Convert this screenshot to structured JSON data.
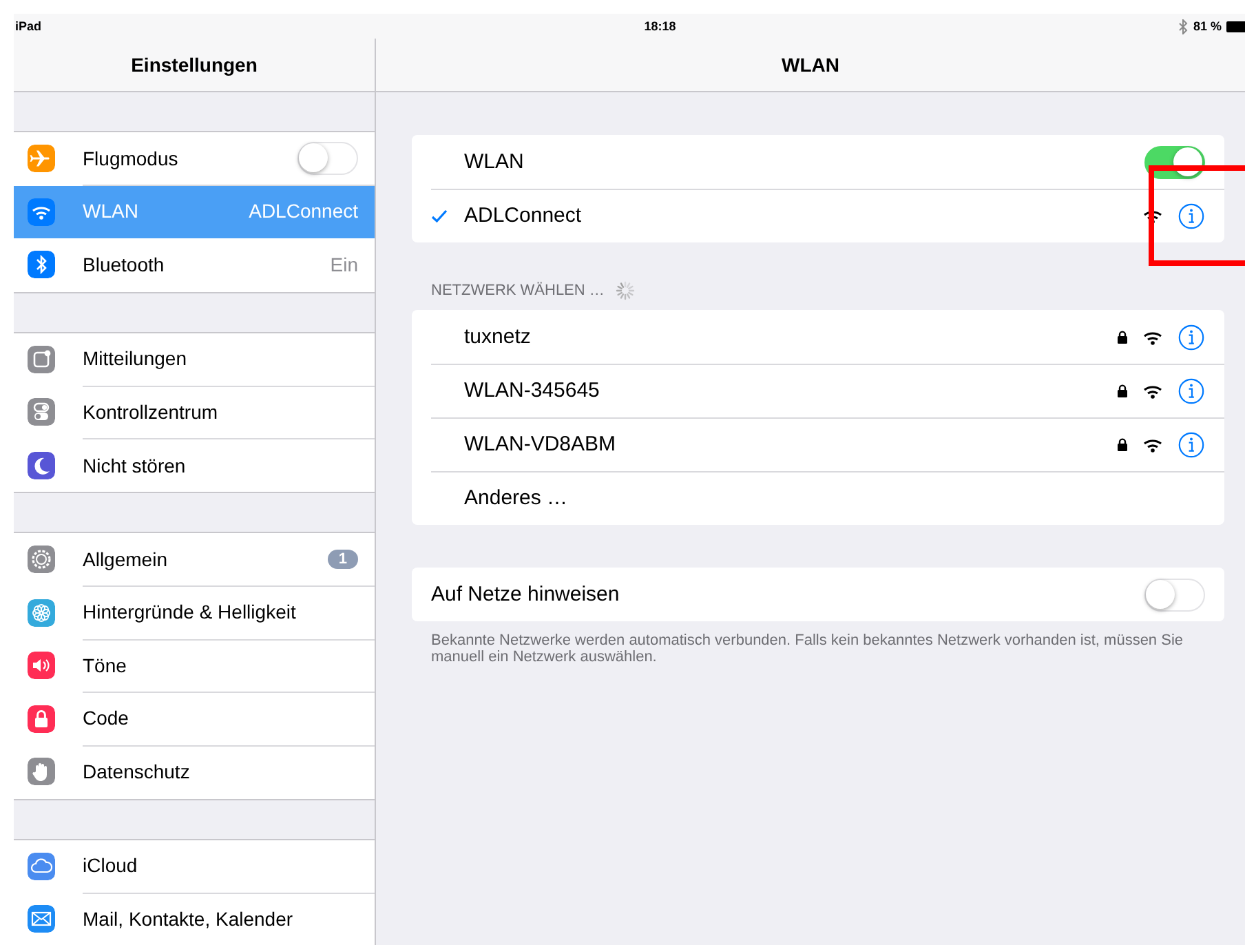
{
  "status_bar": {
    "device": "iPad",
    "time": "18:18",
    "battery": "81 %"
  },
  "sidebar": {
    "title": "Einstellungen",
    "groups": [
      [
        {
          "kind": "toggle",
          "label": "Flugmodus",
          "on": false,
          "selected": false,
          "color": "#ff9500"
        },
        {
          "kind": "value",
          "label": "WLAN",
          "value": "ADLConnect",
          "selected": true,
          "color": "#007aff"
        },
        {
          "kind": "value",
          "label": "Bluetooth",
          "value": "Ein",
          "selected": false,
          "color": "#007aff"
        }
      ],
      [
        {
          "kind": "plain",
          "label": "Mitteilungen",
          "selected": false,
          "color": "#8e8e93"
        },
        {
          "kind": "plain",
          "label": "Kontrollzentrum",
          "selected": false,
          "color": "#8e8e93"
        },
        {
          "kind": "plain",
          "label": "Nicht stören",
          "selected": false,
          "color": "#5856d6"
        }
      ],
      [
        {
          "kind": "badge",
          "label": "Allgemein",
          "badge": "1",
          "selected": false,
          "color": "#8e8e93"
        },
        {
          "kind": "plain",
          "label": "Hintergründe & Helligkeit",
          "selected": false,
          "color": "#34aadc"
        },
        {
          "kind": "plain",
          "label": "Töne",
          "selected": false,
          "color": "#ff2d55"
        },
        {
          "kind": "plain",
          "label": "Code",
          "selected": false,
          "color": "#ff2d55"
        },
        {
          "kind": "plain",
          "label": "Datenschutz",
          "selected": false,
          "color": "#8e8e93"
        }
      ],
      [
        {
          "kind": "plain",
          "label": "iCloud",
          "selected": false,
          "color": "#4a8cf0"
        },
        {
          "kind": "plain",
          "label": "Mail, Kontakte, Kalender",
          "selected": false,
          "color": "#1d8cf5"
        }
      ]
    ]
  },
  "detail": {
    "title": "WLAN",
    "wlan_toggle": {
      "label": "WLAN",
      "on": true
    },
    "connected": {
      "name": "ADLConnect",
      "checked": true
    },
    "section_header": "NETZWERK WÄHLEN …",
    "networks": [
      {
        "name": "tuxnetz",
        "locked": true
      },
      {
        "name": "WLAN-345645",
        "locked": true
      },
      {
        "name": "WLAN-VD8ABM",
        "locked": true
      }
    ],
    "other": "Anderes …",
    "notify_toggle": {
      "label": "Auf Netze hinweisen",
      "on": false
    },
    "footer": "Bekannte Netzwerke werden automatisch verbunden. Falls kein bekanntes Netzwerk vorhanden ist, müssen Sie manuell ein Netzwerk auswählen."
  },
  "annotations": [
    {
      "kind": "frame"
    }
  ]
}
